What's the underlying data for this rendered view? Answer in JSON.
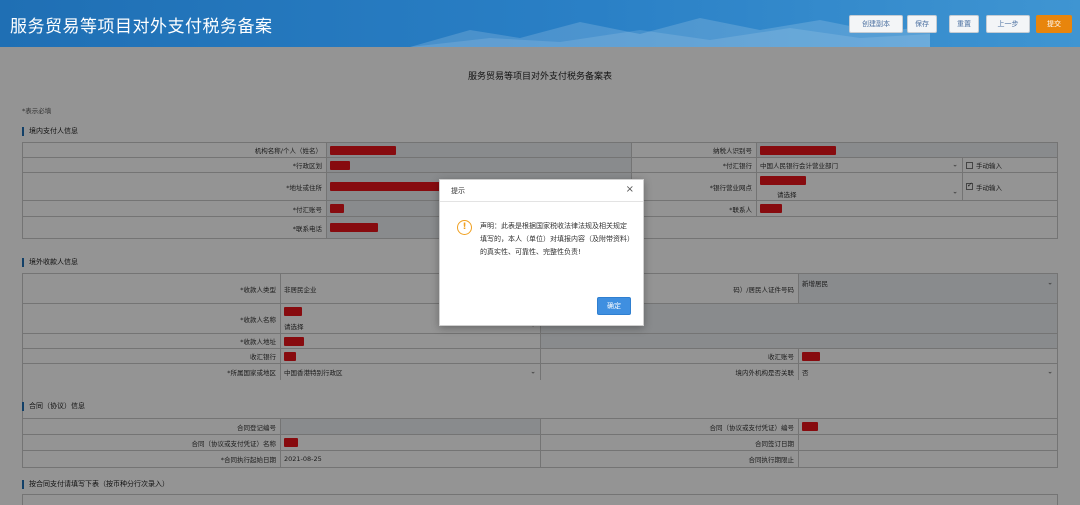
{
  "header": {
    "title": "服务贸易等项目对外支付税务备案",
    "buttons": {
      "create": "创建副本",
      "save": "保存",
      "reset": "重置",
      "prev": "上一步",
      "submit": "提交"
    },
    "brand_color": "#2a80c6",
    "submit_color": "#e8850c"
  },
  "form": {
    "title": "服务贸易等项目对外支付税务备案表",
    "required_note": "*表示必填",
    "domestic": {
      "section_title": "境内支付人信息",
      "org_name_label": "机构名称/个人（姓名）",
      "taxpayer_id_label": "纳税人识别号",
      "admin_region_label": "*行政区划",
      "pay_bank_label": "*付汇银行",
      "pay_bank_value": "中国人民银行会计营业部门",
      "manual_input_1": "手动输入",
      "address_label": "*地址或住所",
      "bank_branch_label": "*银行营业网点",
      "bank_branch_value": "请选择",
      "manual_input_2": "手动输入",
      "account_label": "*付汇账号",
      "contact_label": "*联系人",
      "phone_label": "*联系电话"
    },
    "overseas": {
      "section_title": "境外收款人信息",
      "payee_type_label": "*收款人类型",
      "payee_type_value": "非居民企业",
      "id_label": "码）/居民人证件号码",
      "id_value": "新增居民",
      "payee_name_label": "*收款人名称",
      "payee_name_select": "请选择",
      "payee_address_label": "*收款人地址",
      "receive_bank_label": "收汇银行",
      "receive_account_label": "收汇账号",
      "region_label": "*所属国家或地区",
      "region_value": "中国香港特别行政区",
      "permanent_label": "境内外机构是否关联",
      "permanent_value": "否"
    },
    "contract": {
      "section_title": "合同（协议）信息",
      "reg_no_label": "合同登记编号",
      "contract_no_label": "合同（协议或支付凭证）编号",
      "contract_name_label": "合同（协议或支付凭证）名称",
      "sign_date_label": "合同签订日期",
      "start_date_label": "*合同执行起始日期",
      "start_date_value": "2021-08-25",
      "end_date_label": "合同执行期限止"
    },
    "installments": {
      "section_title": "按合同支付请填写下表（按币种分行次录入）"
    }
  },
  "dialog": {
    "title": "提示",
    "close": "×",
    "icon": "!",
    "message": "声明：此表是根据国家税收法律法规及相关规定填写的，本人（单位）对填报内容（及附带资料）的真实性、可靠性、完整性负责!",
    "confirm": "确定",
    "confirm_color": "#3f8fe0"
  }
}
